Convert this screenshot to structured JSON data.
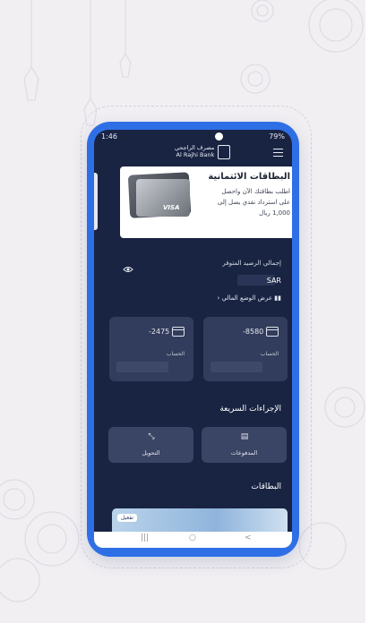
{
  "status_bar": {
    "time": "1:46",
    "indicators": "79%"
  },
  "brand": {
    "name_ar": "مصرف الراجحي",
    "name_en": "Al Rajhi Bank"
  },
  "promo": {
    "title": "البطاقات الائتمانية",
    "body": "اطلب بطاقتك الآن واحصل على استرداد نقدي يصل إلى 1,000 ريال",
    "card_brand": "VISA"
  },
  "balance": {
    "label": "إجمالي الرصيد المتوفر",
    "currency": "SAR",
    "financial_status_link": "عرض الوضع المالي"
  },
  "accounts": [
    {
      "number": "-8580",
      "label": "الحساب"
    },
    {
      "number": "-2475",
      "label": "الحساب"
    }
  ],
  "quick_actions": {
    "title": "الإجراءات السريعة",
    "items": [
      {
        "label": "المدفوعات",
        "icon": "document-icon"
      },
      {
        "label": "التحويل",
        "icon": "transfer-arrows-icon"
      }
    ]
  },
  "cards_section": {
    "title": "البطاقات",
    "activate_label": "تفعيل"
  },
  "nav": {
    "recents": "|||",
    "home": "○",
    "back": "<"
  },
  "colors": {
    "phone_frame": "#2f6fe6",
    "screen_bg": "#192443",
    "tile_bg": "#323c5c"
  }
}
